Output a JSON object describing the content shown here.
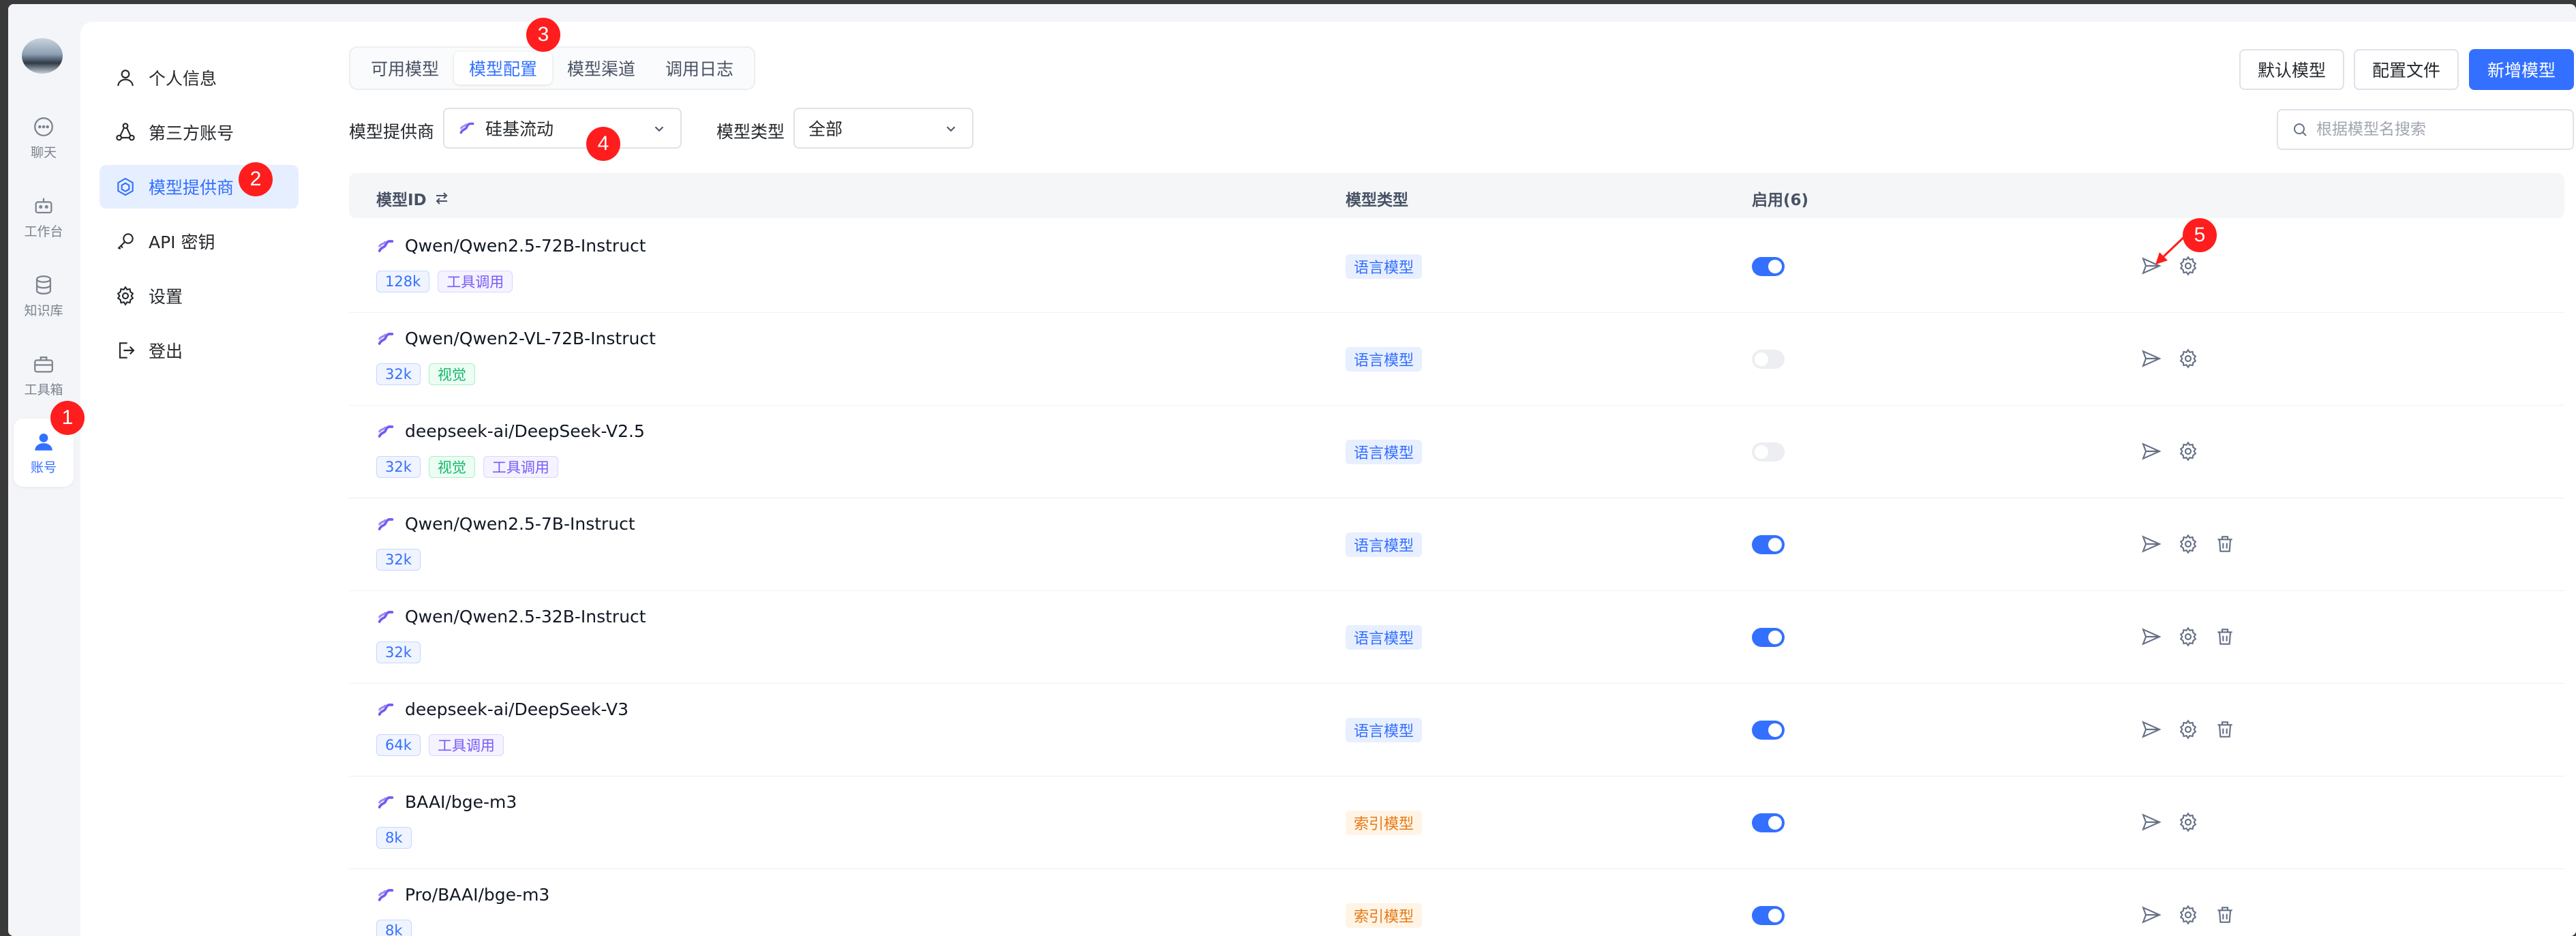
{
  "rail": {
    "items": [
      {
        "label": "聊天",
        "icon": "chat-icon"
      },
      {
        "label": "工作台",
        "icon": "robot-icon"
      },
      {
        "label": "知识库",
        "icon": "database-icon"
      },
      {
        "label": "工具箱",
        "icon": "toolbox-icon"
      },
      {
        "label": "账号",
        "icon": "user-icon"
      }
    ]
  },
  "side": {
    "items": [
      {
        "label": "个人信息",
        "icon": "person-icon"
      },
      {
        "label": "第三方账号",
        "icon": "link-icon"
      },
      {
        "label": "模型提供商",
        "icon": "model-provider-icon"
      },
      {
        "label": "API 密钥",
        "icon": "key-icon"
      },
      {
        "label": "设置",
        "icon": "gear-icon"
      },
      {
        "label": "登出",
        "icon": "logout-icon"
      }
    ]
  },
  "tabs": [
    "可用模型",
    "模型配置",
    "模型渠道",
    "调用日志"
  ],
  "buttons": {
    "default_model": "默认模型",
    "config_file": "配置文件",
    "add_model": "新增模型"
  },
  "filters": {
    "provider_label": "模型提供商",
    "provider_value": "硅基流动",
    "type_label": "模型类型",
    "type_value": "全部"
  },
  "search": {
    "placeholder": "根据模型名搜索"
  },
  "table": {
    "headers": {
      "id": "模型ID",
      "type": "模型类型",
      "enabled": "启用(6)"
    },
    "rows": [
      {
        "name": "Qwen/Qwen2.5-72B-Instruct",
        "tags": [
          "128k",
          "工具调用"
        ],
        "type": "语言模型",
        "enabled": true
      },
      {
        "name": "Qwen/Qwen2-VL-72B-Instruct",
        "tags": [
          "32k",
          "视觉"
        ],
        "type": "语言模型",
        "enabled": false
      },
      {
        "name": "deepseek-ai/DeepSeek-V2.5",
        "tags": [
          "32k",
          "视觉",
          "工具调用"
        ],
        "type": "语言模型",
        "enabled": false
      },
      {
        "name": "Qwen/Qwen2.5-7B-Instruct",
        "tags": [
          "32k"
        ],
        "type": "语言模型",
        "enabled": true
      },
      {
        "name": "Qwen/Qwen2.5-32B-Instruct",
        "tags": [
          "32k"
        ],
        "type": "语言模型",
        "enabled": true
      },
      {
        "name": "deepseek-ai/DeepSeek-V3",
        "tags": [
          "64k",
          "工具调用"
        ],
        "type": "语言模型",
        "enabled": true
      },
      {
        "name": "BAAI/bge-m3",
        "tags": [
          "8k"
        ],
        "type": "索引模型",
        "enabled": true
      },
      {
        "name": "Pro/BAAI/bge-m3",
        "tags": [
          "8k"
        ],
        "type": "索引模型",
        "enabled": true
      }
    ]
  },
  "markers": [
    "1",
    "2",
    "3",
    "4",
    "5"
  ],
  "colors": {
    "accent": "#3370ff",
    "marker": "#ff1d1d"
  }
}
